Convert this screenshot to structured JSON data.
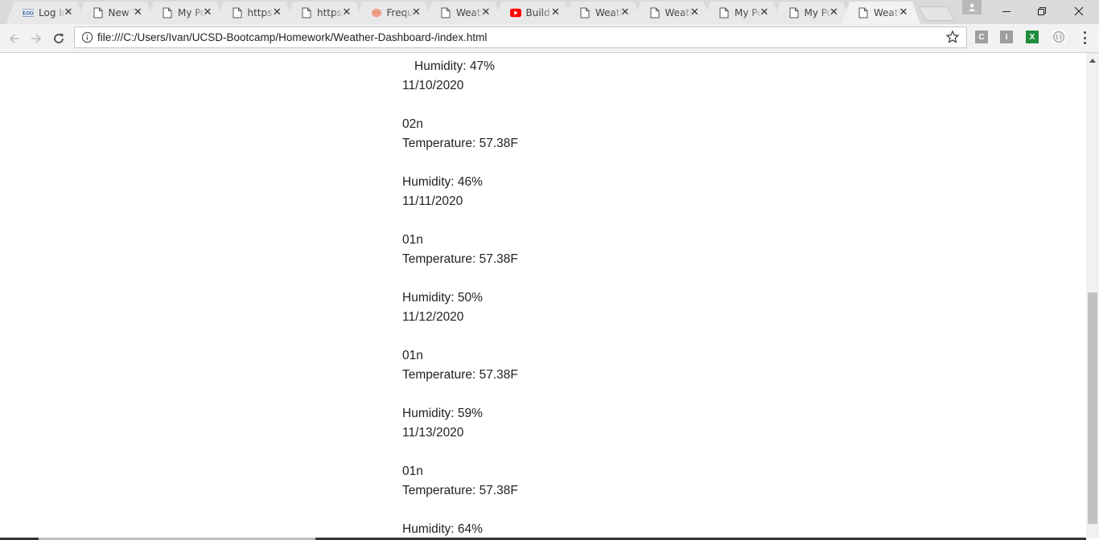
{
  "browser": {
    "tabs": [
      {
        "title": "Log In",
        "icon": "edd-icon",
        "active": false
      },
      {
        "title": "New Tab",
        "icon": "page-icon",
        "active": false
      },
      {
        "title": "My Portfolio",
        "icon": "page-icon",
        "active": false
      },
      {
        "title": "https://",
        "icon": "page-icon",
        "active": false
      },
      {
        "title": "https://",
        "icon": "page-icon",
        "active": false
      },
      {
        "title": "Frequently",
        "icon": "octocat-icon",
        "active": false
      },
      {
        "title": "Weather",
        "icon": "page-icon",
        "active": false
      },
      {
        "title": "Build",
        "icon": "youtube-icon",
        "active": false
      },
      {
        "title": "Weather",
        "icon": "page-icon",
        "active": false
      },
      {
        "title": "Weather",
        "icon": "page-icon",
        "active": false
      },
      {
        "title": "My Portfolio",
        "icon": "page-icon",
        "active": false
      },
      {
        "title": "My Portfolio",
        "icon": "page-icon",
        "active": false
      },
      {
        "title": "Weather",
        "icon": "page-icon",
        "active": true
      }
    ],
    "tab_close_glyph": "✕",
    "address_bar": {
      "url": "file:///C:/Users/Ivan/UCSD-Bootcamp/Homework/Weather-Dashboard-/index.html"
    },
    "extensions": [
      {
        "label": "C",
        "color": "#9e9e9e"
      },
      {
        "label": "I",
        "color": "#9e9e9e"
      },
      {
        "label": "X",
        "color": "#1e8e3e"
      },
      {
        "label": "",
        "color": "#ffffff"
      }
    ],
    "window_controls": {
      "minimize": "–",
      "maximize": "❐",
      "close": "✕"
    }
  },
  "page": {
    "lines": [
      "Humidity: 47%",
      "11/10/2020",
      "02n",
      "Temperature: 57.38F",
      "Humidity: 46%",
      "11/11/2020",
      "01n",
      "Temperature: 57.38F",
      "Humidity: 50%",
      "11/12/2020",
      "01n",
      "Temperature: 57.38F",
      "Humidity: 59%",
      "11/13/2020",
      "01n",
      "Temperature: 57.38F",
      "Humidity: 64%"
    ]
  }
}
